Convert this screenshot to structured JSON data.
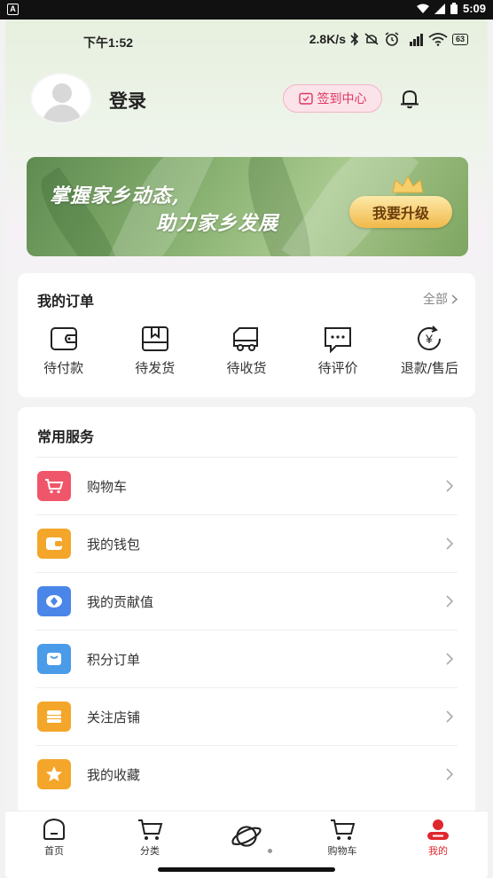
{
  "system_bar": {
    "time": "5:09",
    "badge": "A"
  },
  "status_bar": {
    "time": "下午1:52",
    "speed": "2.8K/s",
    "battery": "63"
  },
  "profile": {
    "login_label": "登录",
    "signin_label": "签到中心"
  },
  "banner": {
    "line1": "掌握家乡动态,",
    "line2": "助力家乡发展",
    "upgrade_label": "我要升级"
  },
  "orders": {
    "title": "我的订单",
    "all_label": "全部",
    "items": [
      {
        "label": "待付款",
        "icon": "wallet-icon"
      },
      {
        "label": "待发货",
        "icon": "package-icon"
      },
      {
        "label": "待收货",
        "icon": "truck-icon"
      },
      {
        "label": "待评价",
        "icon": "comment-icon"
      },
      {
        "label": "退款/售后",
        "icon": "refund-icon"
      }
    ]
  },
  "services": {
    "title": "常用服务",
    "items": [
      {
        "label": "购物车",
        "icon": "cart-icon",
        "color": "#f0566a"
      },
      {
        "label": "我的钱包",
        "icon": "wallet-icon",
        "color": "#f4a62a"
      },
      {
        "label": "我的贡献值",
        "icon": "contribution-icon",
        "color": "#4a86e8"
      },
      {
        "label": "积分订单",
        "icon": "points-bag-icon",
        "color": "#4a9be8"
      },
      {
        "label": "关注店铺",
        "icon": "store-icon",
        "color": "#f4a62a"
      },
      {
        "label": "我的收藏",
        "icon": "star-icon",
        "color": "#f4a62a"
      }
    ]
  },
  "bottom_nav": {
    "items": [
      {
        "label": "首页",
        "icon": "home-icon"
      },
      {
        "label": "分类",
        "icon": "cart-icon"
      },
      {
        "label": "",
        "icon": "planet-icon"
      },
      {
        "label": "购物车",
        "icon": "cart-icon"
      },
      {
        "label": "我的",
        "icon": "profile-icon",
        "active": true
      }
    ],
    "active_color": "#e0262d"
  }
}
